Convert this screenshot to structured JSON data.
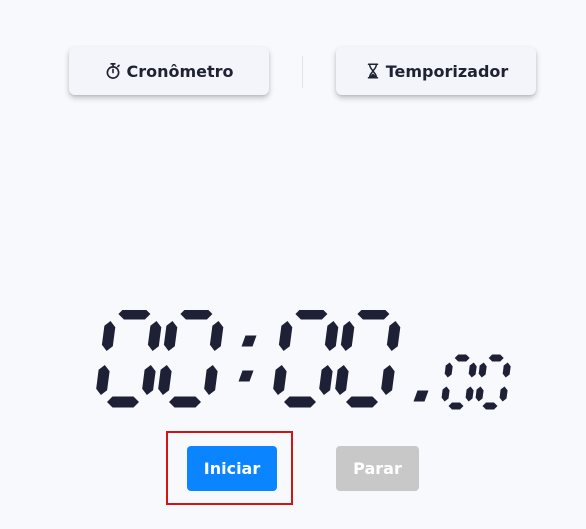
{
  "tabs": {
    "stopwatch": {
      "label": "Cronômetro",
      "icon": "stopwatch-icon"
    },
    "timer": {
      "label": "Temporizador",
      "icon": "hourglass-icon"
    }
  },
  "display": {
    "minutes": "00",
    "separator": ":",
    "seconds": "00",
    "hundredths": "00",
    "color": "#1e2036"
  },
  "controls": {
    "start": {
      "label": "Iniciar",
      "color": "#0a84ff",
      "enabled": true
    },
    "stop": {
      "label": "Parar",
      "color": "#c8c8c8",
      "enabled": false
    }
  },
  "colors": {
    "background": "#f8f9fd",
    "tab_background": "#f4f5fb",
    "highlight": "#d21414"
  }
}
